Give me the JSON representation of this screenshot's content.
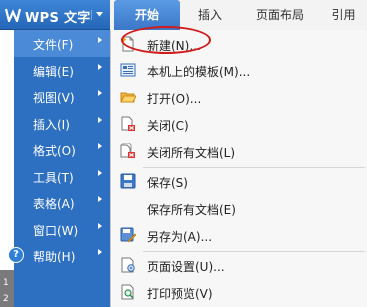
{
  "app": {
    "title": "WPS 文字"
  },
  "tabs": [
    {
      "label": "开始"
    },
    {
      "label": "插入"
    },
    {
      "label": "页面布局"
    },
    {
      "label": "引用"
    }
  ],
  "left_menu": {
    "items": [
      {
        "label": "文件(F)"
      },
      {
        "label": "编辑(E)"
      },
      {
        "label": "视图(V)"
      },
      {
        "label": "插入(I)"
      },
      {
        "label": "格式(O)"
      },
      {
        "label": "工具(T)"
      },
      {
        "label": "表格(A)"
      },
      {
        "label": "窗口(W)"
      },
      {
        "label": "帮助(H)"
      }
    ],
    "strip_labels": [
      "1",
      "2"
    ]
  },
  "file_submenu": {
    "items": [
      {
        "label": "新建(N)...",
        "icon": "new-document-icon"
      },
      {
        "label": "本机上的模板(M)...",
        "icon": "template-icon"
      },
      {
        "label": "打开(O)...",
        "icon": "open-folder-icon"
      },
      {
        "label": "关闭(C)",
        "icon": "close-document-icon"
      },
      {
        "label": "关闭所有文档(L)",
        "icon": "close-all-icon"
      },
      {
        "label": "保存(S)",
        "icon": "save-icon"
      },
      {
        "label": "保存所有文档(E)",
        "icon": ""
      },
      {
        "label": "另存为(A)...",
        "icon": "save-as-icon"
      },
      {
        "label": "页面设置(U)...",
        "icon": "page-setup-icon"
      },
      {
        "label": "打印预览(V)",
        "icon": "print-preview-icon"
      }
    ]
  },
  "colors": {
    "menu_blue": "#2d6fc0",
    "active_blue": "#4a8ad6",
    "highlight_red": "#d21a1a"
  }
}
